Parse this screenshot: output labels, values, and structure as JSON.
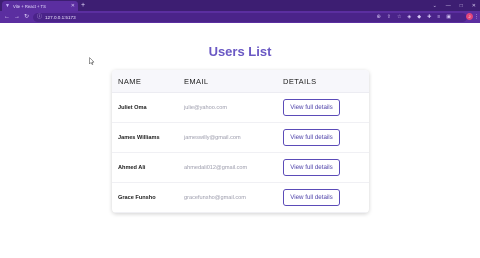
{
  "browser": {
    "tab_title": "Vite + React + TS",
    "url": "127.0.0.1:5173"
  },
  "page": {
    "title": "Users List",
    "columns": {
      "name": "NAME",
      "email": "EMAIL",
      "details": "DETAILS"
    },
    "rows": [
      {
        "name": "Juliet Oma",
        "email": "julie@yahoo.com",
        "action": "View full details"
      },
      {
        "name": "James Williams",
        "email": "jameswilly@gmail.com",
        "action": "View full details"
      },
      {
        "name": "Ahmed Ali",
        "email": "ahmedali012@gmail.com",
        "action": "View full details"
      },
      {
        "name": "Grace Funsho",
        "email": "gracefunsho@gmail.com",
        "action": "View full details"
      }
    ]
  },
  "colors": {
    "title": "#6a58c4",
    "button_border": "#5b4bb8",
    "chrome": "#5b2ea0"
  }
}
